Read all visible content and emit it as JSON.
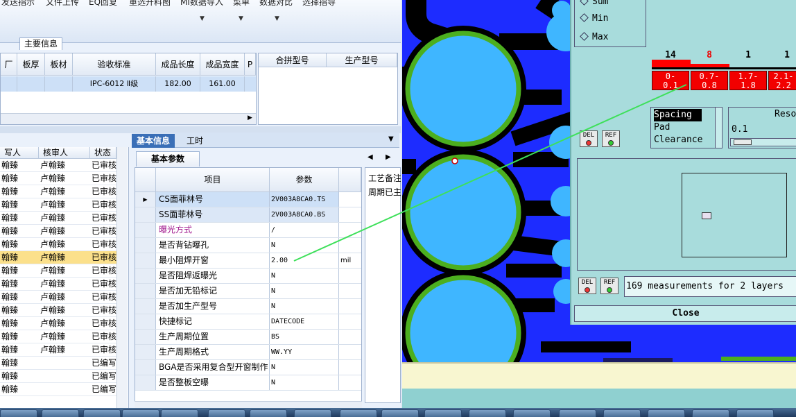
{
  "ribbon": {
    "buttons": [
      "发送指示",
      "文件上传",
      "EQ回复",
      "重选开料图",
      "MI数据导入",
      "菜单",
      "数据对比",
      "选择指导"
    ]
  },
  "left_top": {
    "section_tab": "主要信息",
    "columns": [
      "厂",
      "板厚",
      "板材",
      "验收标准",
      "成品长度",
      "成品宽度",
      "P"
    ],
    "row": [
      "",
      "",
      "",
      "IPC-6012 Ⅱ级",
      "182.00",
      "161.00",
      ""
    ],
    "right_columns": [
      "合拼型号",
      "生产型号"
    ]
  },
  "left_list": {
    "columns": [
      "写人",
      "核审人",
      "状态"
    ],
    "rows": [
      [
        "翰臻",
        "卢翰臻",
        "已审核"
      ],
      [
        "翰臻",
        "卢翰臻",
        "已审核"
      ],
      [
        "翰臻",
        "卢翰臻",
        "已审核"
      ],
      [
        "翰臻",
        "卢翰臻",
        "已审核"
      ],
      [
        "翰臻",
        "卢翰臻",
        "已审核"
      ],
      [
        "翰臻",
        "卢翰臻",
        "已审核"
      ],
      [
        "翰臻",
        "卢翰臻",
        "已审核"
      ],
      [
        "翰臻",
        "卢翰臻",
        "已审核"
      ],
      [
        "翰臻",
        "卢翰臻",
        "已审核"
      ],
      [
        "翰臻",
        "卢翰臻",
        "已审核"
      ],
      [
        "翰臻",
        "卢翰臻",
        "已审核"
      ],
      [
        "翰臻",
        "卢翰臻",
        "已审核"
      ],
      [
        "翰臻",
        "卢翰臻",
        "已审核"
      ],
      [
        "翰臻",
        "卢翰臻",
        "已审核"
      ],
      [
        "翰臻",
        "卢翰臻",
        "已审核"
      ],
      [
        "翰臻",
        "",
        "已编写"
      ],
      [
        "翰臻",
        "",
        "已编写"
      ],
      [
        "翰臻",
        "",
        "已编写"
      ]
    ]
  },
  "right_panel": {
    "tabs": [
      "基本信息",
      "工时"
    ],
    "subtab": "基本参数",
    "grid_columns": [
      "项目",
      "参数"
    ],
    "rows": [
      {
        "item": "CS面菲林号",
        "value": "2V003A8CA0.TS",
        "unit": ""
      },
      {
        "item": "SS面菲林号",
        "value": "2V003A8CA0.BS",
        "unit": ""
      },
      {
        "item": "曝光方式",
        "value": "/",
        "unit": ""
      },
      {
        "item": "是否背钻曝孔",
        "value": "N",
        "unit": ""
      },
      {
        "item": "最小阻焊开窗",
        "value": "2.00",
        "unit": "mil"
      },
      {
        "item": "是否阻焊返曝光",
        "value": "N",
        "unit": ""
      },
      {
        "item": "是否加无铅标记",
        "value": "N",
        "unit": ""
      },
      {
        "item": "是否加生产型号",
        "value": "N",
        "unit": ""
      },
      {
        "item": "快捷标记",
        "value": "DATECODE",
        "unit": ""
      },
      {
        "item": "生产周期位置",
        "value": "BS",
        "unit": ""
      },
      {
        "item": "生产周期格式",
        "value": "WW.YY",
        "unit": ""
      },
      {
        "item": "BGA是否采用复合型开窗制作",
        "value": "N",
        "unit": ""
      },
      {
        "item": "是否整板空曝",
        "value": "N",
        "unit": ""
      }
    ],
    "side_panel": [
      "工艺备注",
      "周期已主"
    ]
  },
  "dialog": {
    "radios": [
      "Sum",
      "Min",
      "Max"
    ],
    "histogram_counts": [
      "14",
      "8",
      "1",
      "1"
    ],
    "bins": [
      [
        "0-",
        "0.1"
      ],
      [
        "0.7-",
        "0.8"
      ],
      [
        "1.7-",
        "1.8"
      ],
      [
        "2.1-",
        "2.2"
      ]
    ],
    "list_items": [
      "Spacing",
      "Pad",
      "Clearance"
    ],
    "res_label": "Reso",
    "res_value": "0.1",
    "del_label": "DEL",
    "ref_label": "REF",
    "measurements_text": "169 measurements for 2 layers",
    "close_label": "Close"
  },
  "colors": {
    "pcb_background": "#1d2cff",
    "pad_fill": "#3fb6ff",
    "pad_ring": "#4caf1f",
    "measure_line": "#3ee05a",
    "bin_red": "#f20000"
  }
}
